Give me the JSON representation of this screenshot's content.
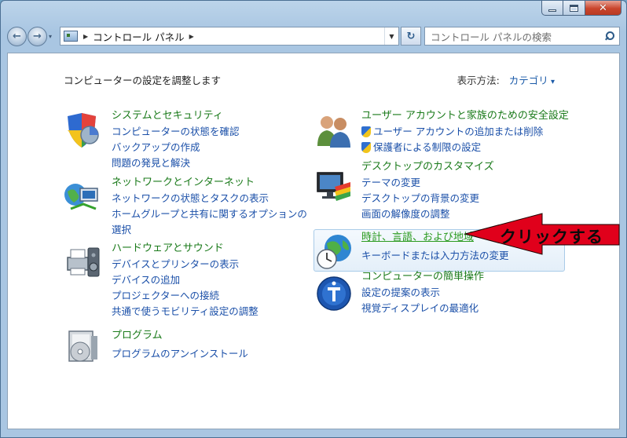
{
  "window": {
    "address": {
      "breadcrumb": "コントロール パネル"
    },
    "search": {
      "placeholder": "コントロール パネルの検索"
    }
  },
  "content": {
    "heading": "コンピューターの設定を調整します",
    "view_by": {
      "label": "表示方法:",
      "value": "カテゴリ"
    },
    "categories_left": [
      {
        "title": "システムとセキュリティ",
        "icon": "shield-pie-icon",
        "links": [
          "コンピューターの状態を確認",
          "バックアップの作成",
          "問題の発見と解決"
        ]
      },
      {
        "title": "ネットワークとインターネット",
        "icon": "network-globe-icon",
        "links": [
          "ネットワークの状態とタスクの表示",
          "ホームグループと共有に関するオプションの",
          "選択"
        ]
      },
      {
        "title": "ハードウェアとサウンド",
        "icon": "printer-speaker-icon",
        "links": [
          "デバイスとプリンターの表示",
          "デバイスの追加",
          "プロジェクターへの接続",
          "共通で使うモビリティ設定の調整"
        ]
      },
      {
        "title": "プログラム",
        "icon": "program-disc-icon",
        "links": [
          "プログラムのアンインストール"
        ]
      }
    ],
    "categories_right": [
      {
        "title": "ユーザー アカウントと家族のための安全設定",
        "icon": "users-icon",
        "links": [
          "ユーザー アカウントの追加または削除",
          "保護者による制限の設定"
        ]
      },
      {
        "title": "デスクトップのカスタマイズ",
        "icon": "monitor-palette-icon",
        "links": [
          "テーマの変更",
          "デスクトップの背景の変更",
          "画面の解像度の調整"
        ]
      },
      {
        "title": "時計、言語、および地域",
        "icon": "globe-clock-icon",
        "links": [
          "キーボードまたは入力方法の変更"
        ]
      },
      {
        "title": "コンピューターの簡単操作",
        "icon": "ease-of-access-icon",
        "links": [
          "設定の提案の表示",
          "視覚ディスプレイの最適化"
        ]
      }
    ]
  },
  "annotation": {
    "text": "クリックする",
    "color": "#e0001b"
  }
}
